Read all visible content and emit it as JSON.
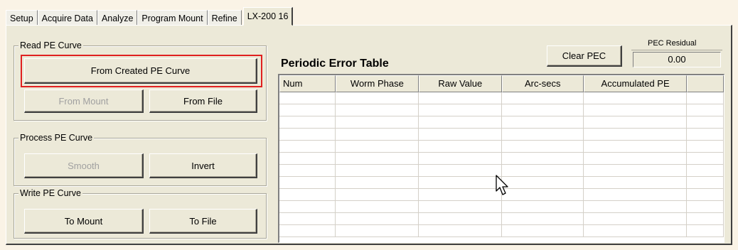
{
  "tabs": [
    "Setup",
    "Acquire Data",
    "Analyze",
    "Program Mount",
    "Refine",
    "LX-200 16"
  ],
  "active_tab": "LX-200 16",
  "read_group": {
    "title": "Read PE Curve",
    "from_created": "From Created PE Curve",
    "from_mount": "From Mount",
    "from_file": "From File"
  },
  "process_group": {
    "title": "Process PE Curve",
    "smooth": "Smooth",
    "invert": "Invert"
  },
  "write_group": {
    "title": "Write PE Curve",
    "to_mount": "To Mount",
    "to_file": "To File"
  },
  "table": {
    "title": "Periodic Error Table",
    "columns": [
      "Num",
      "Worm Phase",
      "Raw Value",
      "Arc-secs",
      "Accumulated PE",
      ""
    ],
    "rows": []
  },
  "clear_pec": "Clear PEC",
  "pec_residual": {
    "label": "PEC Residual",
    "value": "0.00"
  },
  "icons": {
    "cursor": "arrow-cursor-icon"
  },
  "colors": {
    "highlight": "#e02020",
    "panel": "#ece9d8"
  }
}
